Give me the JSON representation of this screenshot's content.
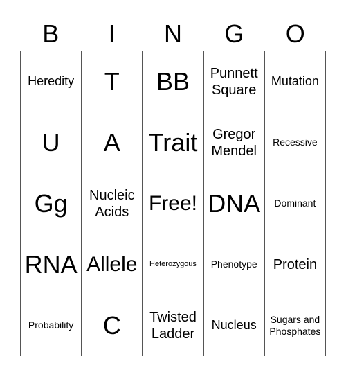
{
  "header": [
    "B",
    "I",
    "N",
    "G",
    "O"
  ],
  "cells": [
    [
      {
        "text": "Heredity",
        "size": "s-s"
      },
      {
        "text": "T",
        "size": "s-xl"
      },
      {
        "text": "BB",
        "size": "s-xl"
      },
      {
        "text": "Punnett Square",
        "size": "s-m"
      },
      {
        "text": "Mutation",
        "size": "s-s"
      }
    ],
    [
      {
        "text": "U",
        "size": "s-xl"
      },
      {
        "text": "A",
        "size": "s-xl"
      },
      {
        "text": "Trait",
        "size": "s-xl"
      },
      {
        "text": "Gregor Mendel",
        "size": "s-m"
      },
      {
        "text": "Recessive",
        "size": "s-xs"
      }
    ],
    [
      {
        "text": "Gg",
        "size": "s-xl"
      },
      {
        "text": "Nucleic Acids",
        "size": "s-m"
      },
      {
        "text": "Free!",
        "size": "s-l"
      },
      {
        "text": "DNA",
        "size": "s-xl"
      },
      {
        "text": "Dominant",
        "size": "s-xs"
      }
    ],
    [
      {
        "text": "RNA",
        "size": "s-xl"
      },
      {
        "text": "Allele",
        "size": "s-l"
      },
      {
        "text": "Heterozygous",
        "size": "s-xxs"
      },
      {
        "text": "Phenotype",
        "size": "s-xs"
      },
      {
        "text": "Protein",
        "size": "s-m"
      }
    ],
    [
      {
        "text": "Probability",
        "size": "s-xs"
      },
      {
        "text": "C",
        "size": "s-xl"
      },
      {
        "text": "Twisted Ladder",
        "size": "s-m"
      },
      {
        "text": "Nucleus",
        "size": "s-s"
      },
      {
        "text": "Sugars and Phosphates",
        "size": "s-xs"
      }
    ]
  ]
}
